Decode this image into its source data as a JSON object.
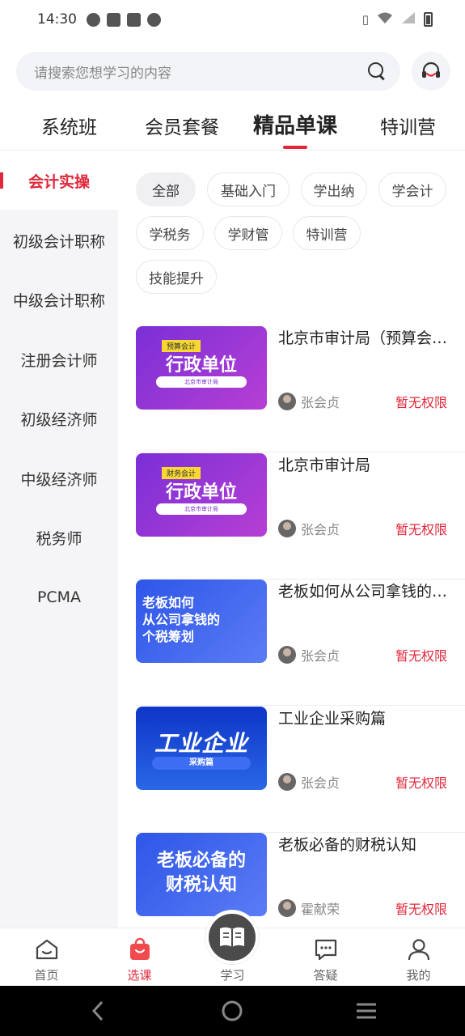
{
  "status_bar": {
    "time": "14:30",
    "icons": [
      "data-saver-icon",
      "mail-icon",
      "mail-icon",
      "shield-icon"
    ],
    "right_icons": [
      "vibrate-icon",
      "wifi-icon",
      "signal-icon",
      "battery-icon"
    ]
  },
  "search": {
    "placeholder": "请搜索您想学习的内容"
  },
  "top_tabs": [
    {
      "label": "系统班"
    },
    {
      "label": "会员套餐"
    },
    {
      "label": "精品单课",
      "active": true
    },
    {
      "label": "特训营"
    }
  ],
  "sidebar": {
    "items": [
      {
        "label": "会计实操",
        "active": true
      },
      {
        "label": "初级会计职称"
      },
      {
        "label": "中级会计职称"
      },
      {
        "label": "注册会计师"
      },
      {
        "label": "初级经济师"
      },
      {
        "label": "中级经济师"
      },
      {
        "label": "税务师"
      },
      {
        "label": "PCMA"
      }
    ]
  },
  "filters": [
    {
      "label": "全部",
      "active": true
    },
    {
      "label": "基础入门"
    },
    {
      "label": "学出纳"
    },
    {
      "label": "学会计"
    },
    {
      "label": "学税务"
    },
    {
      "label": "学财管"
    },
    {
      "label": "特训营"
    },
    {
      "label": "技能提升"
    }
  ],
  "courses": [
    {
      "title": "北京市审计局（预算会计）",
      "teacher": "张会贞",
      "permission": "暂无权限",
      "thumb": {
        "tag": "预算会计",
        "main": "行政单位",
        "pill": "北京市审计局"
      }
    },
    {
      "title": "北京市审计局",
      "teacher": "张会贞",
      "permission": "暂无权限",
      "thumb": {
        "tag": "财务会计",
        "main": "行政单位",
        "pill": "北京市审计局"
      }
    },
    {
      "title": "老板如何从公司拿钱的个税筹划",
      "teacher": "张会贞",
      "permission": "暂无权限",
      "thumb": {
        "line1": "老板如何",
        "line2": "从公司拿钱的",
        "line3": "个税筹划"
      }
    },
    {
      "title": "工业企业采购篇",
      "teacher": "张会贞",
      "permission": "暂无权限",
      "thumb": {
        "main": "工业企业",
        "pill": "采购篇"
      }
    },
    {
      "title": "老板必备的财税认知",
      "teacher": "霍献荣",
      "permission": "暂无权限",
      "thumb": {
        "line1": "老板必备的",
        "line2": "财税认知"
      }
    }
  ],
  "bottom_nav": [
    {
      "label": "首页",
      "icon": "home-icon"
    },
    {
      "label": "选课",
      "icon": "bag-icon",
      "active": true
    },
    {
      "label": "学习",
      "icon": "book-icon"
    },
    {
      "label": "答疑",
      "icon": "chat-icon"
    },
    {
      "label": "我的",
      "icon": "user-icon"
    }
  ],
  "colors": {
    "accent": "#e0283a",
    "sidebar_bg": "#f5f5f7",
    "text": "#222222"
  }
}
